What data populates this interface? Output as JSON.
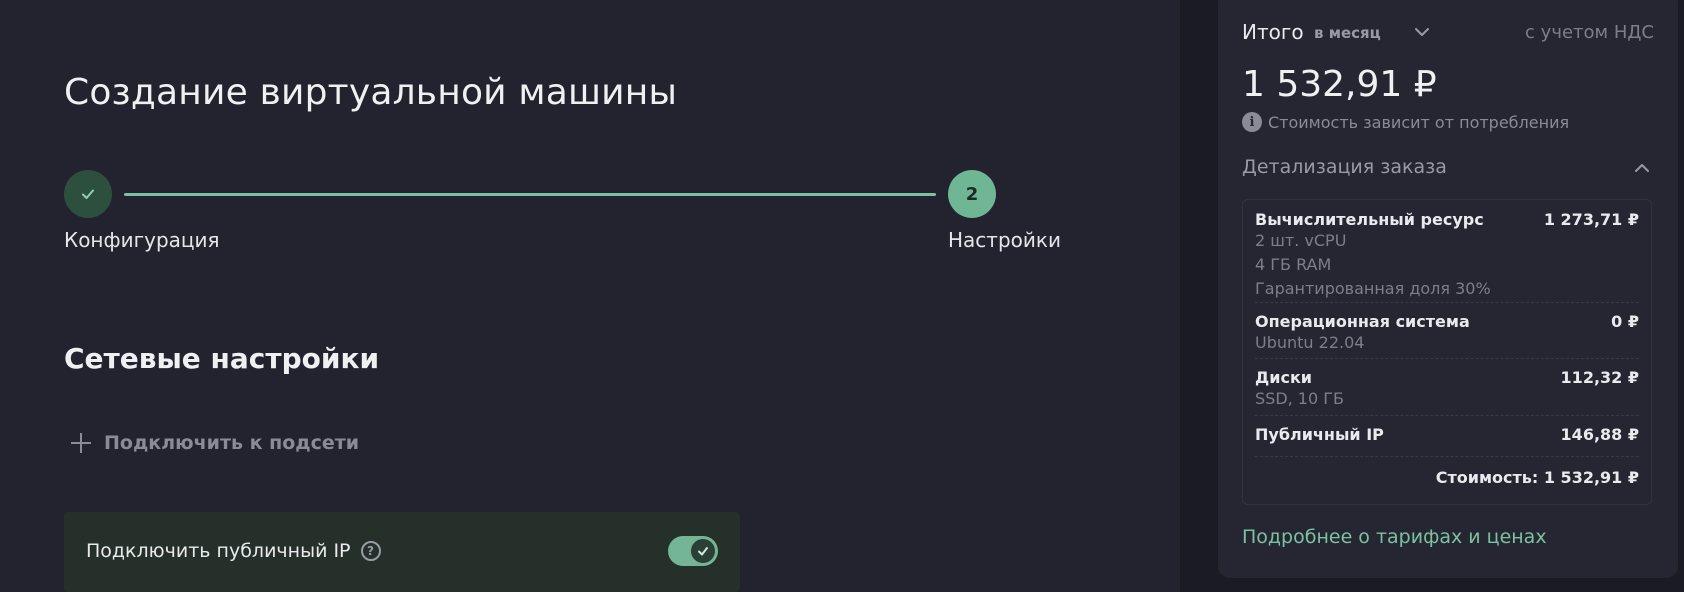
{
  "main": {
    "title": "Создание виртуальной машины",
    "stepper": {
      "steps": [
        {
          "label": "Конфигурация",
          "state": "done"
        },
        {
          "label": "Настройки",
          "number": "2",
          "state": "active"
        }
      ]
    },
    "network": {
      "section_title": "Сетевые настройки",
      "add_subnet_label": "Подключить к подсети",
      "public_ip_label": "Подключить публичный IP",
      "public_ip_enabled": true
    }
  },
  "summary": {
    "total_label": "Итого",
    "period": "в месяц",
    "vat_note": "с учетом НДС",
    "total_price": "1 532,91 ₽",
    "consumption_note": "Стоимость зависит от потребления",
    "details_title": "Детализация заказа",
    "items": [
      {
        "name": "Вычислительный ресурс",
        "price": "1 273,71 ₽",
        "details": [
          "2 шт. vCPU",
          "4 ГБ RAM",
          "Гарантированная доля 30%"
        ]
      },
      {
        "name": "Операционная система",
        "price": "0 ₽",
        "details": [
          "Ubuntu 22.04"
        ]
      },
      {
        "name": "Диски",
        "price": "112,32 ₽",
        "details": [
          "SSD, 10 ГБ"
        ]
      },
      {
        "name": "Публичный IP",
        "price": "146,88 ₽",
        "details": []
      }
    ],
    "cost_total": "Стоимость: 1 532,91 ₽",
    "tariff_link": "Подробнее о тарифах и ценах"
  },
  "colors": {
    "accent": "#7cc1a0",
    "background": "#232330",
    "panel": "#262633"
  }
}
